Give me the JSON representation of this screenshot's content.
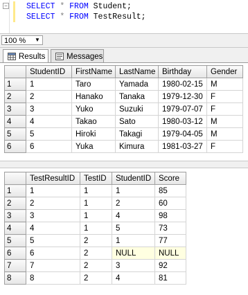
{
  "editor": {
    "lines": [
      {
        "kw1": "SELECT",
        "op": "*",
        "kw2": "FROM",
        "obj": "Student;"
      },
      {
        "kw1": "SELECT",
        "op": "*",
        "kw2": "FROM",
        "obj": "TestResult;"
      }
    ]
  },
  "zoom": {
    "value": "100 %"
  },
  "tabs": [
    {
      "label": "Results",
      "icon": "grid-icon"
    },
    {
      "label": "Messages",
      "icon": "messages-icon"
    }
  ],
  "student_grid": {
    "columns": [
      "StudentID",
      "FirstName",
      "LastName",
      "Birthday",
      "Gender"
    ],
    "rows": [
      {
        "num": "1",
        "cells": [
          "1",
          "Taro",
          "Yamada",
          "1980-02-15",
          "M"
        ]
      },
      {
        "num": "2",
        "cells": [
          "2",
          "Hanako",
          "Tanaka",
          "1979-12-30",
          "F"
        ]
      },
      {
        "num": "3",
        "cells": [
          "3",
          "Yuko",
          "Suzuki",
          "1979-07-07",
          "F"
        ]
      },
      {
        "num": "4",
        "cells": [
          "4",
          "Takao",
          "Sato",
          "1980-03-12",
          "M"
        ]
      },
      {
        "num": "5",
        "cells": [
          "5",
          "Hiroki",
          "Takagi",
          "1979-04-05",
          "M"
        ]
      },
      {
        "num": "6",
        "cells": [
          "6",
          "Yuka",
          "Kimura",
          "1981-03-27",
          "F"
        ]
      }
    ]
  },
  "testresult_grid": {
    "columns": [
      "TestResultID",
      "TestID",
      "StudentID",
      "Score"
    ],
    "rows": [
      {
        "num": "1",
        "cells": [
          "1",
          "1",
          "1",
          "85"
        ]
      },
      {
        "num": "2",
        "cells": [
          "2",
          "1",
          "2",
          "60"
        ]
      },
      {
        "num": "3",
        "cells": [
          "3",
          "1",
          "4",
          "98"
        ]
      },
      {
        "num": "4",
        "cells": [
          "4",
          "1",
          "5",
          "73"
        ]
      },
      {
        "num": "5",
        "cells": [
          "5",
          "2",
          "1",
          "77"
        ]
      },
      {
        "num": "6",
        "cells": [
          "6",
          "2",
          "NULL",
          "NULL"
        ]
      },
      {
        "num": "7",
        "cells": [
          "7",
          "2",
          "3",
          "92"
        ]
      },
      {
        "num": "8",
        "cells": [
          "8",
          "2",
          "4",
          "81"
        ]
      }
    ]
  },
  "colors": {
    "keyword": "#0000ff",
    "null_bg": "#ffffe1",
    "change_bar": "#ffe98a"
  }
}
